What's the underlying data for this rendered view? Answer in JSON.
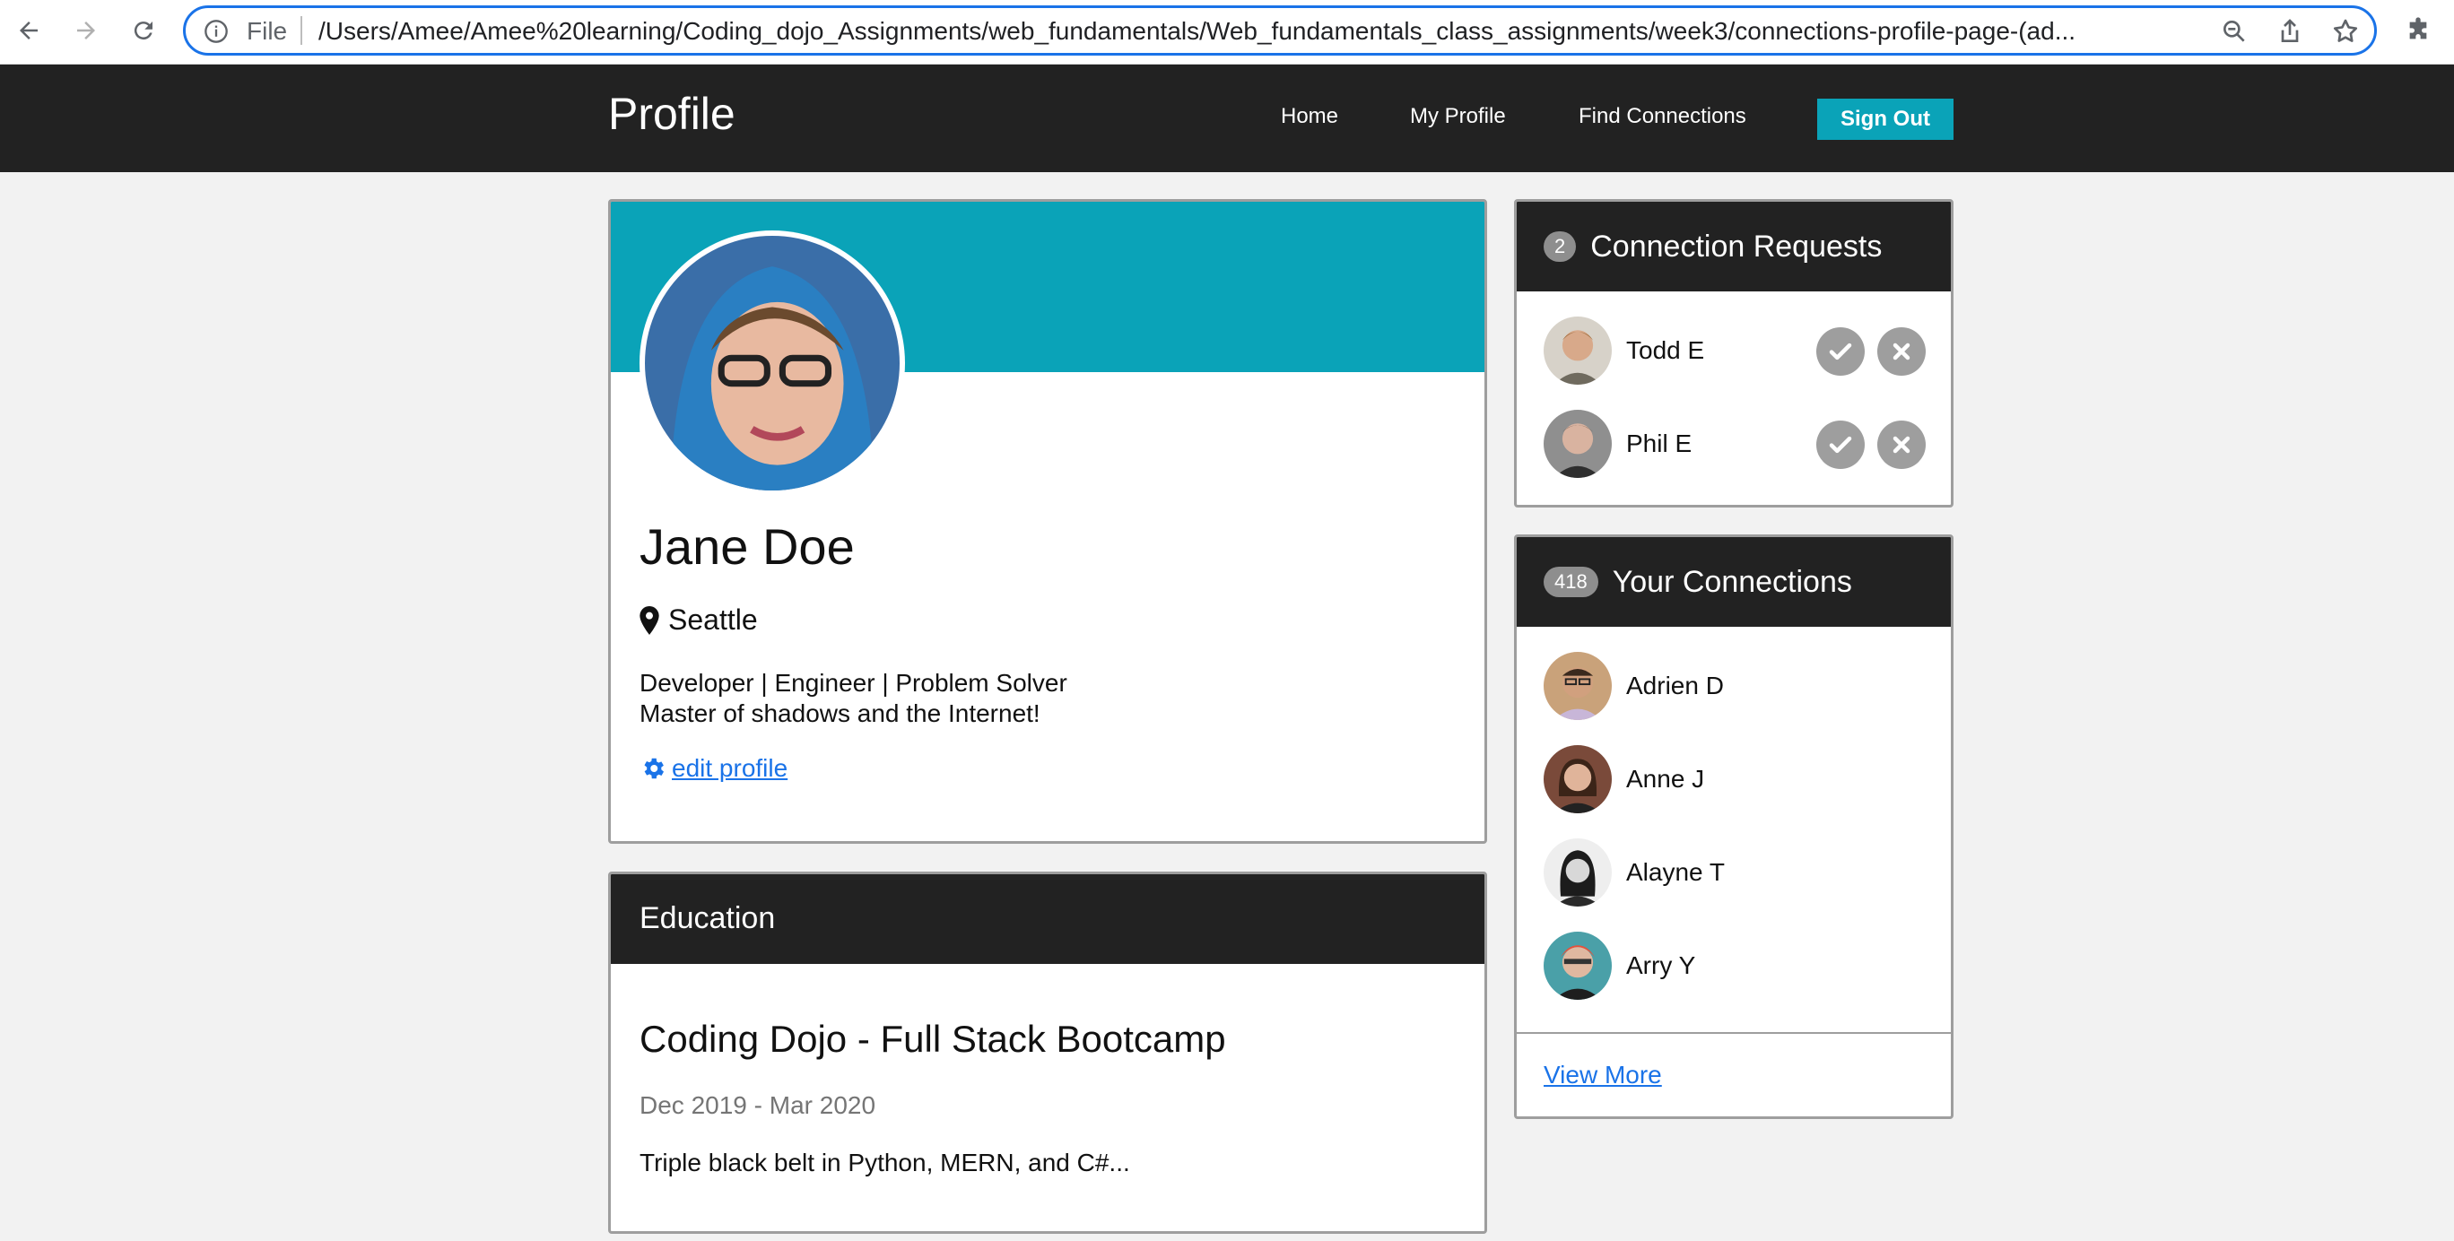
{
  "browser": {
    "scheme_label": "File",
    "url": "/Users/Amee/Amee%20learning/Coding_dojo_Assignments/web_fundamentals/Web_fundamentals_class_assignments/week3/connections-profile-page-(ad..."
  },
  "nav": {
    "brand": "Profile",
    "links": [
      "Home",
      "My Profile",
      "Find Connections"
    ],
    "signout_label": "Sign Out"
  },
  "profile": {
    "name": "Jane Doe",
    "location": "Seattle",
    "bio_line1": "Developer | Engineer | Problem Solver",
    "bio_line2": "Master of shadows and the Internet!",
    "edit_label": " edit profile"
  },
  "education": {
    "header": "Education",
    "school": "Coding Dojo - Full Stack Bootcamp",
    "dates": "Dec 2019 - Mar 2020",
    "description": "Triple black belt in Python, MERN, and C#..."
  },
  "requests": {
    "count": "2",
    "title": "Connection Requests",
    "items": [
      {
        "name": "Todd E"
      },
      {
        "name": "Phil E"
      }
    ]
  },
  "connections": {
    "count": "418",
    "title": "Your Connections",
    "items": [
      {
        "name": "Adrien D"
      },
      {
        "name": "Anne J"
      },
      {
        "name": "Alayne T"
      },
      {
        "name": "Arry Y"
      }
    ],
    "view_more": "View More"
  },
  "colors": {
    "accent": "#0aa3b8",
    "dark": "#222222",
    "link": "#1a73e8"
  }
}
